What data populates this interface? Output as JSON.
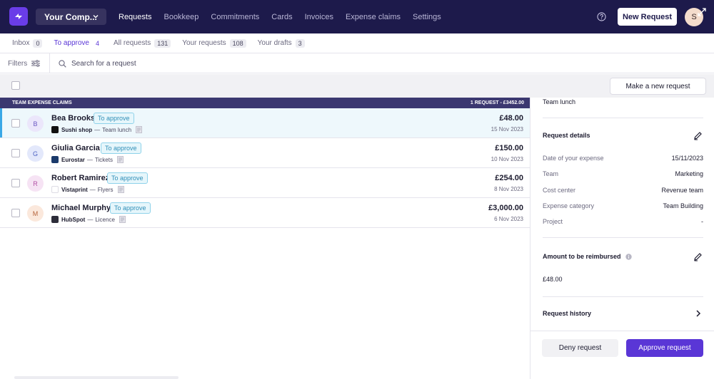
{
  "nav": {
    "company": "Your Comp...",
    "links": [
      "Requests",
      "Bookkeep",
      "Commitments",
      "Cards",
      "Invoices",
      "Expense claims",
      "Settings"
    ],
    "active_link": "Requests",
    "new_request_label": "New Request",
    "avatar_initial": "S"
  },
  "tabs": [
    {
      "label": "Inbox",
      "count": "0"
    },
    {
      "label": "To approve",
      "count": "4"
    },
    {
      "label": "All requests",
      "count": "131"
    },
    {
      "label": "Your requests",
      "count": "108"
    },
    {
      "label": "Your drafts",
      "count": "3"
    }
  ],
  "active_tab": "To approve",
  "filters": {
    "label": "Filters",
    "search_placeholder": "Search for a request"
  },
  "list_toolbar": {
    "make_new_label": "Make a new request"
  },
  "group": {
    "title": "TEAM EXPENSE CLAIMS",
    "summary": "1 REQUEST - £3452.00"
  },
  "rows": [
    {
      "initial": "B",
      "name": "Bea Brooks",
      "status": "To approve",
      "merchant": "Sushi shop",
      "category": "Team lunch",
      "amount": "£48.00",
      "date": "15 Nov 2023",
      "avatar_bg": "#ebe6fb",
      "avatar_fg": "#6a56c2",
      "logo_bg": "#111111",
      "selected": true
    },
    {
      "initial": "G",
      "name": "Giulia Garcia",
      "status": "To approve",
      "merchant": "Eurostar",
      "category": "Tickets",
      "amount": "£150.00",
      "date": "10 Nov 2023",
      "avatar_bg": "#e3e8fb",
      "avatar_fg": "#4e63c2",
      "logo_bg": "#1b3a6b",
      "selected": false
    },
    {
      "initial": "R",
      "name": "Robert Ramirez",
      "status": "To approve",
      "merchant": "Vistaprint",
      "category": "Flyers",
      "amount": "£254.00",
      "date": "8 Nov 2023",
      "avatar_bg": "#f6e3f4",
      "avatar_fg": "#b24fa5",
      "logo_bg": "#ffffff",
      "selected": false
    },
    {
      "initial": "M",
      "name": "Michael Murphy",
      "status": "To approve",
      "merchant": "HubSpot",
      "category": "Licence",
      "amount": "£3,000.00",
      "date": "6 Nov 2023",
      "avatar_bg": "#fbe8dc",
      "avatar_fg": "#b5633a",
      "logo_bg": "#2d2d3a",
      "selected": false
    }
  ],
  "separator": "—",
  "panel": {
    "top_text": "Team lunch",
    "details_title": "Request details",
    "details": [
      {
        "k": "Date of your expense",
        "v": "15/11/2023"
      },
      {
        "k": "Team",
        "v": "Marketing"
      },
      {
        "k": "Cost center",
        "v": "Revenue team"
      },
      {
        "k": "Expense category",
        "v": "Team Building"
      },
      {
        "k": "Project",
        "v": "-"
      }
    ],
    "amount_title": "Amount to be reimbursed",
    "amount_value": "£48.00",
    "history_title": "Request history",
    "deny_label": "Deny request",
    "approve_label": "Approve request"
  },
  "colors": {
    "nav_bg": "#1d1a4b",
    "accent": "#5a36d6",
    "badge": "#2f8fb8"
  }
}
